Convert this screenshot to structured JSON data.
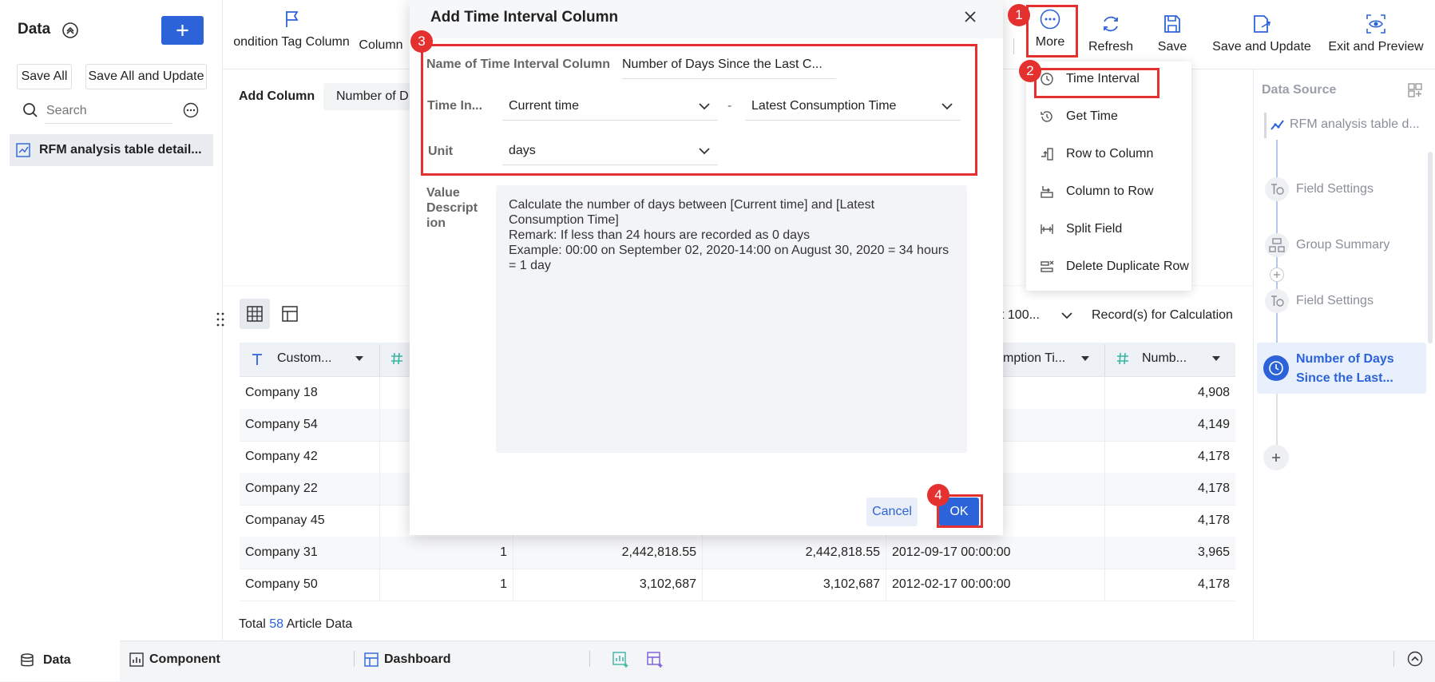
{
  "left": {
    "title": "Data",
    "save_all": "Save All",
    "save_all_update": "Save All and Update",
    "search_placeholder": "Search",
    "table_item": "RFM analysis table detail..."
  },
  "toolbar": {
    "condition_tag": "ondition Tag Column",
    "column": "Column",
    "more": "More",
    "refresh": "Refresh",
    "save": "Save",
    "save_update": "Save and Update",
    "exit_preview": "Exit and Preview"
  },
  "content": {
    "add_column_label": "Add Column",
    "add_column_value": "Number of D",
    "records_select": "t 100...",
    "records_label": "Record(s) for Calculation",
    "total_prefix": "Total",
    "total_count": "58",
    "total_suffix": "Article Data"
  },
  "table": {
    "headers": [
      "Custom...",
      "mption Ti...",
      "Numb..."
    ],
    "rows": [
      {
        "name": "Company 18",
        "a": "",
        "b": "",
        "c": "",
        "date": "00",
        "num": "4,908"
      },
      {
        "name": "Company 54",
        "a": "",
        "b": "",
        "c": "",
        "date": "00",
        "num": "4,149"
      },
      {
        "name": "Company 42",
        "a": "",
        "b": "",
        "c": "",
        "date": "00",
        "num": "4,178"
      },
      {
        "name": "Company 22",
        "a": "",
        "b": "",
        "c": "",
        "date": "00",
        "num": "4,178"
      },
      {
        "name": "Companay 45",
        "a": "",
        "b": "",
        "c": "",
        "date": "00",
        "num": "4,178"
      },
      {
        "name": "Company 31",
        "a": "1",
        "b": "2,442,818.55",
        "c": "2,442,818.55",
        "date": "2012-09-17 00:00:00",
        "num": "3,965"
      },
      {
        "name": "Company 50",
        "a": "1",
        "b": "3,102,687",
        "c": "3,102,687",
        "date": "2012-02-17 00:00:00",
        "num": "4,178"
      }
    ]
  },
  "right": {
    "title": "Data Source",
    "source": "RFM analysis table d...",
    "steps": [
      "Field Settings",
      "Group Summary",
      "Field Settings"
    ],
    "active_step_line1": "Number of Days",
    "active_step_line2": "Since the Last..."
  },
  "bottom": {
    "data": "Data",
    "component": "Component",
    "dashboard": "Dashboard"
  },
  "dialog": {
    "title": "Add Time Interval Column",
    "name_label": "Name of Time Interval Column",
    "name_value": "Number of Days Since the Last C...",
    "time_label": "Time In...",
    "time_from": "Current time",
    "dash": "-",
    "time_to": "Latest Consumption Time",
    "unit_label": "Unit",
    "unit_value": "days",
    "desc_label_1": "Value",
    "desc_label_2": "Descript",
    "desc_label_3": "ion",
    "desc_1": "Calculate the number of days between [Current time] and [Latest",
    "desc_2": "Consumption Time]",
    "desc_3": "Remark: If less than 24 hours are recorded as 0 days",
    "desc_4": "Example: 00:00 on September 02, 2020-14:00 on August 30, 2020 = 34 hours",
    "desc_5": "= 1 day",
    "cancel": "Cancel",
    "ok": "OK"
  },
  "menu": {
    "items": [
      "Time Interval",
      "Get Time",
      "Row to Column",
      "Column to Row",
      "Split Field",
      "Delete Duplicate Row"
    ]
  },
  "badges": [
    "1",
    "2",
    "3",
    "4"
  ],
  "colors": {
    "accent": "#2d63d9",
    "annotation": "#e4312f",
    "active_step_bg": "#e8f0fd"
  }
}
